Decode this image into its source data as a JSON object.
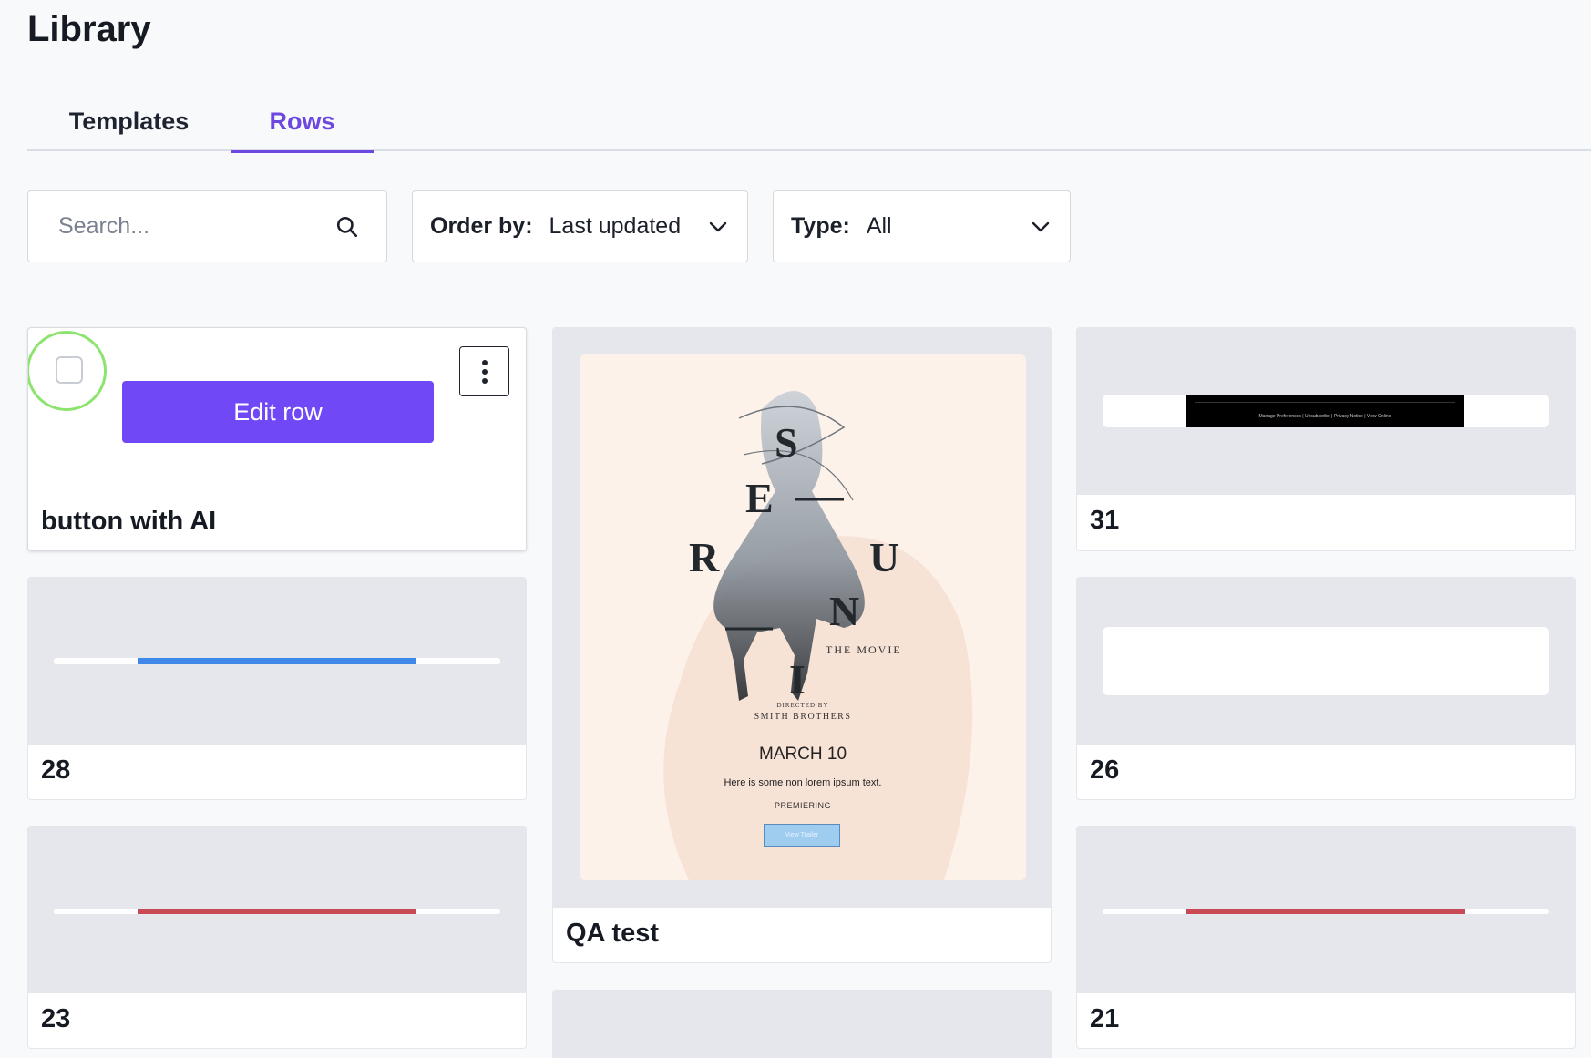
{
  "page": {
    "title": "Library"
  },
  "tabs": [
    {
      "label": "Templates",
      "active": false
    },
    {
      "label": "Rows",
      "active": true
    }
  ],
  "filters": {
    "search_placeholder": "Search...",
    "order_label": "Order by:",
    "order_value": "Last updated",
    "type_label": "Type:",
    "type_value": "All"
  },
  "cards": {
    "button_with_ai": {
      "label": "button with AI",
      "edit_label": "Edit row"
    },
    "c28": {
      "label": "28",
      "bar_color": "#4088e8"
    },
    "c23": {
      "label": "23",
      "bar_color": "#c84a55"
    },
    "qa_test": {
      "label": "QA test"
    },
    "c31": {
      "label": "31",
      "footer_text": "Manage Preferences | Unsubscribe | Privacy Notice | View Online"
    },
    "c26": {
      "label": "26"
    },
    "c21": {
      "label": "21",
      "bar_color": "#c84a55"
    }
  },
  "poster": {
    "letters": [
      "S",
      "E",
      "R",
      "U",
      "N",
      "I"
    ],
    "the_movie": "THE MOVIE",
    "directed_by": "DIRECTED BY",
    "director": "SMITH BROTHERS",
    "date": "MARCH 10",
    "copy": "Here is some non lorem ipsum text.",
    "premiering": "PREMIERING",
    "trailer": "View Trailer"
  },
  "colors": {
    "accent": "#6c47e0",
    "button": "#7148f5",
    "select_ring": "#8ce46f"
  },
  "icons": {
    "search": "search-icon",
    "chevron": "chevron-down-icon",
    "menu": "kebab-menu-icon"
  }
}
